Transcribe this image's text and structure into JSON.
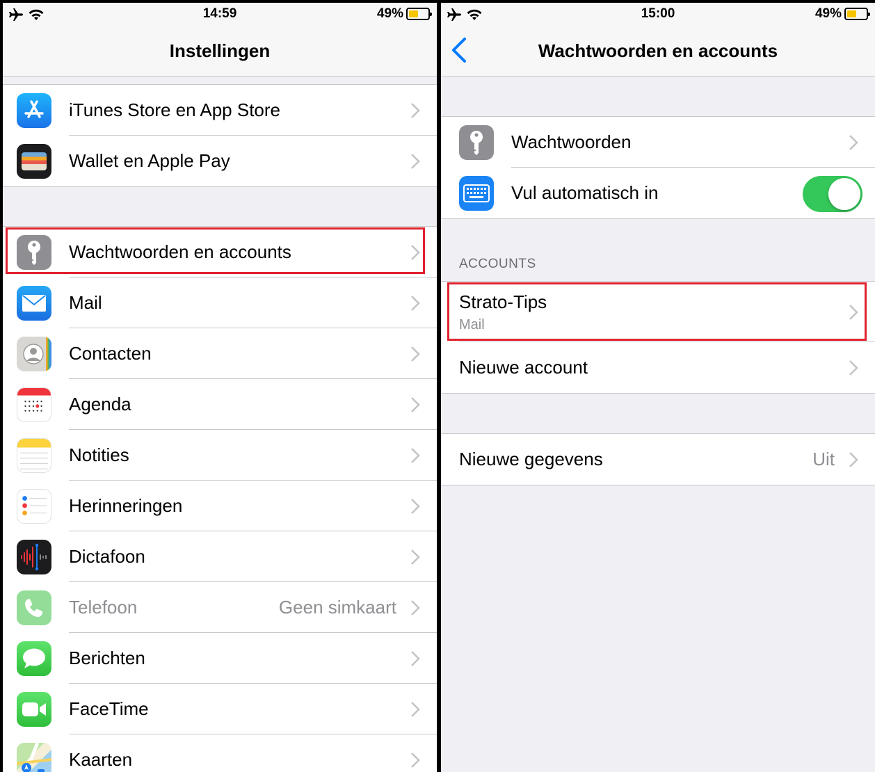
{
  "left": {
    "status": {
      "time": "14:59",
      "battery": "49%",
      "battery_level": 0.49
    },
    "title": "Instellingen",
    "group1": [
      {
        "label": "iTunes Store en App Store",
        "icon": "app-store-icon"
      },
      {
        "label": "Wallet en Apple Pay",
        "icon": "wallet-icon"
      }
    ],
    "group2": [
      {
        "label": "Wachtwoorden en accounts",
        "icon": "key-icon"
      },
      {
        "label": "Mail",
        "icon": "mail-icon"
      },
      {
        "label": "Contacten",
        "icon": "contacts-icon"
      },
      {
        "label": "Agenda",
        "icon": "calendar-icon"
      },
      {
        "label": "Notities",
        "icon": "notes-icon"
      },
      {
        "label": "Herinneringen",
        "icon": "reminders-icon"
      },
      {
        "label": "Dictafoon",
        "icon": "voice-memos-icon"
      },
      {
        "label": "Telefoon",
        "detail": "Geen simkaart",
        "icon": "phone-icon"
      },
      {
        "label": "Berichten",
        "icon": "messages-icon"
      },
      {
        "label": "FaceTime",
        "icon": "facetime-icon"
      },
      {
        "label": "Kaarten",
        "icon": "maps-icon"
      }
    ]
  },
  "right": {
    "status": {
      "time": "15:00",
      "battery": "49%",
      "battery_level": 0.49
    },
    "title": "Wachtwoorden en accounts",
    "passwords_label": "Wachtwoorden",
    "autofill_label": "Vul automatisch in",
    "autofill_on": true,
    "accounts_header": "ACCOUNTS",
    "account_name": "Strato-Tips",
    "account_sub": "Mail",
    "new_account": "Nieuwe account",
    "fetch_label": "Nieuwe gegevens",
    "fetch_value": "Uit"
  },
  "colors": {
    "highlight": "#e0232e",
    "toggle_on": "#34c759",
    "ios_blue": "#007aff"
  }
}
